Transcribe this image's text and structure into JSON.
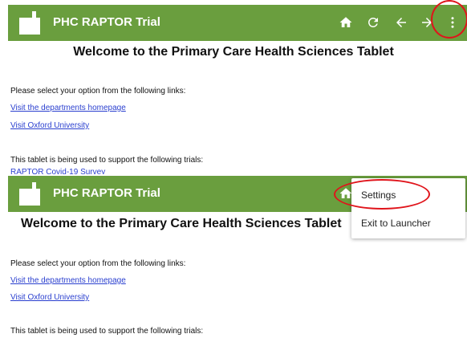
{
  "colors": {
    "appbar": "#6a9e3e",
    "link": "#2a3fcf",
    "highlight": "#e0141b"
  },
  "app": {
    "title": "PHC RAPTOR Trial"
  },
  "toolbar_icons": [
    "home-icon",
    "refresh-icon",
    "back-icon",
    "forward-icon",
    "more-vert-icon"
  ],
  "content": {
    "welcome": "Welcome to the Primary Care Health Sciences Tablet",
    "select_prompt": "Please select your option from the following links:",
    "links": [
      "Visit the departments homepage",
      "Visit Oxford University"
    ],
    "trials_text": "This tablet is being used to support the following trials:",
    "trial_partial": "RAPTOR Covid-19 Survey"
  },
  "menu": {
    "items": [
      "Settings",
      "Exit to Launcher"
    ]
  }
}
